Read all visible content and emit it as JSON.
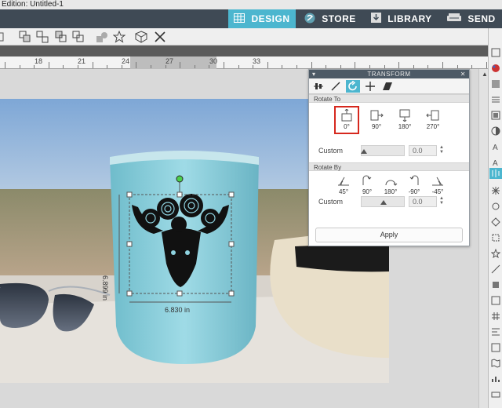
{
  "window": {
    "title": "Edition: Untitled-1"
  },
  "tabs": [
    {
      "label": "DESIGN",
      "icon": "grid-icon",
      "active": true
    },
    {
      "label": "STORE",
      "icon": "store-icon",
      "active": false
    },
    {
      "label": "LIBRARY",
      "icon": "library-icon",
      "active": false
    },
    {
      "label": "SEND",
      "icon": "send-icon",
      "active": false
    }
  ],
  "ruler": {
    "labels": [
      "18",
      "21",
      "24",
      "27",
      "30",
      "33"
    ]
  },
  "panel": {
    "title": "TRANSFORM",
    "rotate_to_header": "Rotate To",
    "rotate_to": [
      "0°",
      "90°",
      "180°",
      "270°"
    ],
    "rotate_to_selected": "0°",
    "custom_label": "Custom",
    "custom_value_1": "0.0",
    "rotate_by_header": "Rotate By",
    "rotate_by": [
      "45°",
      "90°",
      "180°",
      "-90°",
      "-45°"
    ],
    "custom_label_2": "Custom",
    "custom_value_2": "0.0",
    "apply_label": "Apply"
  },
  "selection": {
    "width_label": "6.830 in",
    "height_label": "6.899 in"
  },
  "colors": {
    "accent": "#4cb6cf",
    "tabbar": "#3f4a55",
    "tumbler": "#8fd3e0",
    "highlight": "#d6281e"
  }
}
